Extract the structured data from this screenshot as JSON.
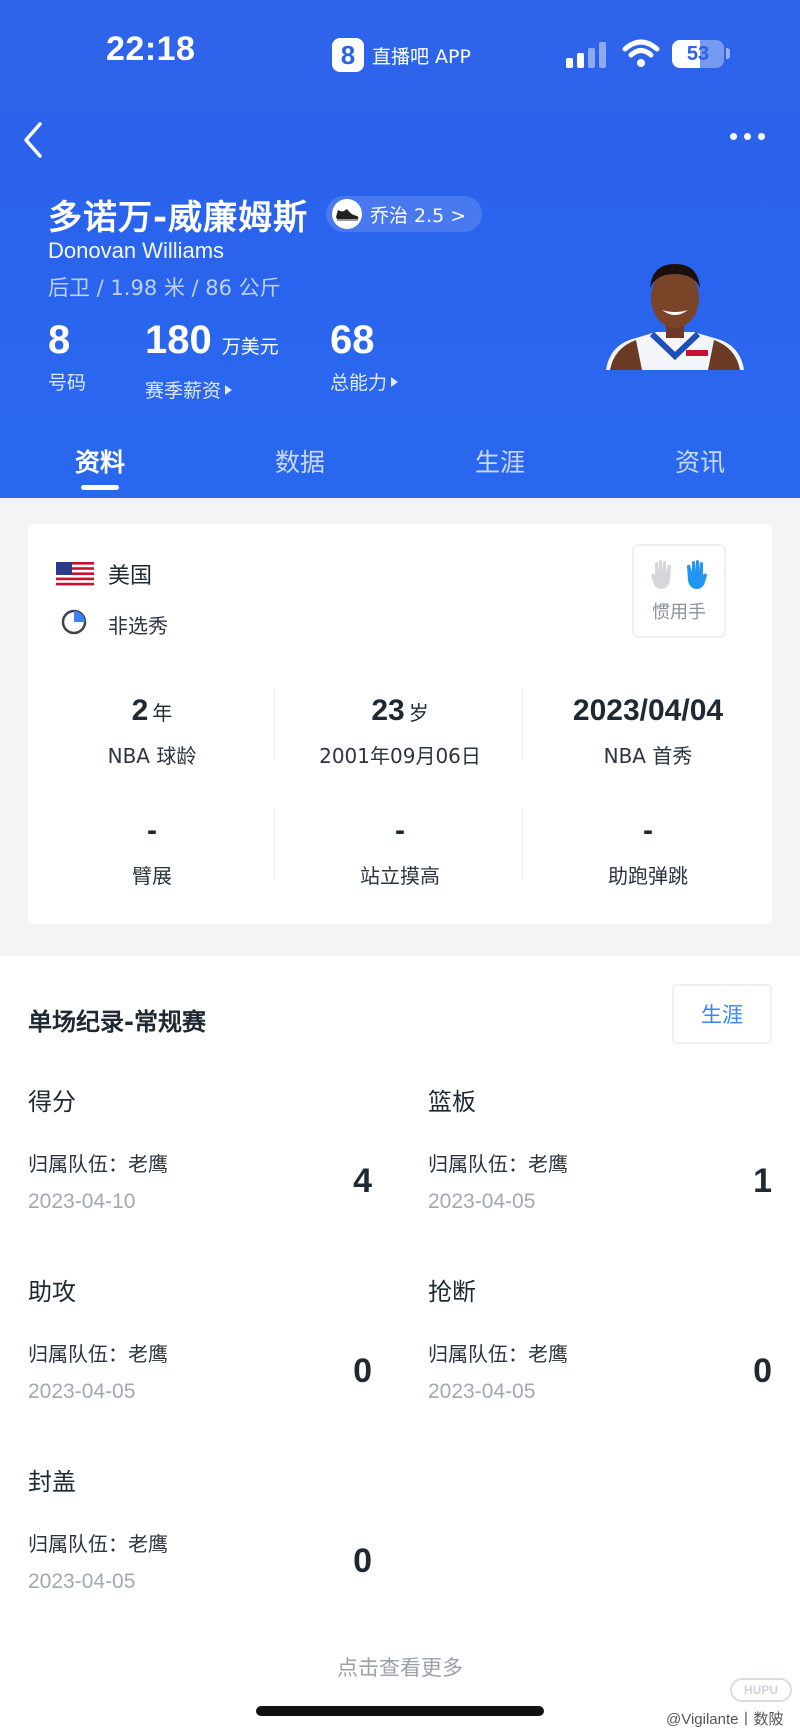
{
  "status_bar": {
    "time": "22:18",
    "app_name": "直播吧 APP",
    "app_logo_text": "8",
    "battery": "53",
    "battery_level": 0.53
  },
  "player": {
    "name_cn": "多诺万-威廉姆斯",
    "shoe": "乔治 2.5 >",
    "name_en": "Donovan Williams",
    "meta": "后卫 / 1.98 米 / 86 公斤",
    "number_value": "8",
    "number_label": "号码",
    "salary_value": "180",
    "salary_unit": "万美元",
    "salary_label": "赛季薪资",
    "rating_value": "68",
    "rating_label": "总能力"
  },
  "tabs": [
    {
      "label": "资料",
      "active": true
    },
    {
      "label": "数据",
      "active": false
    },
    {
      "label": "生涯",
      "active": false
    },
    {
      "label": "资讯",
      "active": false
    }
  ],
  "info": {
    "country": "美国",
    "draft": "非选秀",
    "hand_label": "惯用手",
    "grid": [
      {
        "value": "2",
        "unit": "年",
        "label": "NBA 球龄"
      },
      {
        "value": "23",
        "unit": "岁",
        "label": "2001年09月06日"
      },
      {
        "value": "2023/04/04",
        "unit": "",
        "label": "NBA 首秀"
      },
      {
        "value": "-",
        "unit": "",
        "label": "臂展"
      },
      {
        "value": "-",
        "unit": "",
        "label": "站立摸高"
      },
      {
        "value": "-",
        "unit": "",
        "label": "助跑弹跳"
      }
    ]
  },
  "records": {
    "title": "单场纪录-常规赛",
    "career_button": "生涯",
    "items": [
      {
        "category": "得分",
        "team": "归属队伍：老鹰",
        "date": "2023-04-10",
        "value": "4"
      },
      {
        "category": "篮板",
        "team": "归属队伍：老鹰",
        "date": "2023-04-05",
        "value": "1"
      },
      {
        "category": "助攻",
        "team": "归属队伍：老鹰",
        "date": "2023-04-05",
        "value": "0"
      },
      {
        "category": "抢断",
        "team": "归属队伍：老鹰",
        "date": "2023-04-05",
        "value": "0"
      },
      {
        "category": "封盖",
        "team": "归属队伍：老鹰",
        "date": "2023-04-05",
        "value": "0"
      }
    ],
    "view_more": "点击查看更多"
  },
  "watermark": "@Vigilante丨数陂",
  "hupu_mark": "HUPU",
  "colors": {
    "header_blue": "#2a62ec",
    "accent_blue": "#3b82f6",
    "hand_active": "#2196f3"
  }
}
